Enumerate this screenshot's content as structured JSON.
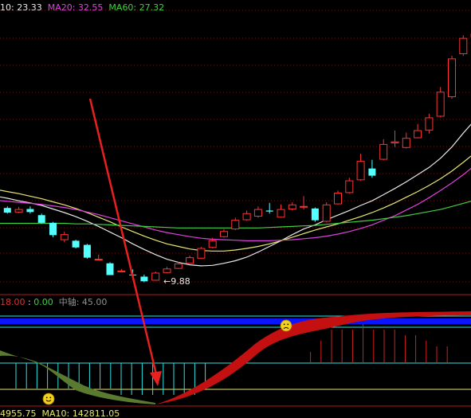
{
  "legend_top": [
    {
      "text": "10: 23.33",
      "color": "#e8e8e8"
    },
    {
      "text": "MA20: 32.55",
      "color": "#e040e0"
    },
    {
      "text": "MA60: 27.32",
      "color": "#40d040"
    }
  ],
  "legend_mid": [
    {
      "text": "18.00",
      "color": "#e03030"
    },
    {
      "text": " : ",
      "color": "#e8e8e8"
    },
    {
      "text": "0.00",
      "color": "#40d040"
    },
    {
      "text": "  中轴: 45.00",
      "color": "#909090"
    }
  ],
  "bottom_left": "4955.75",
  "bottom_ma10": "MA10: 142811.05",
  "low_marker": "9.88",
  "colors": {
    "up": "#ff3232",
    "down": "#54ffff",
    "ma10": "#e8e8e8",
    "ma_mid": "#e8e870",
    "ma20": "#e040e0",
    "ma60": "#40d040",
    "arrow": "#e82020",
    "band_red": "#c41010",
    "band_green": "#5a7a30",
    "blue_band": "#0a14ff"
  },
  "chart_data": [
    {
      "type": "candlestick",
      "series": [
        {
          "name": "candles",
          "ohlc": [
            [
              23.6,
              23.0,
              24.1,
              22.9
            ],
            [
              22.9,
              22.0,
              23.2,
              21.8
            ],
            [
              22.1,
              22.6,
              23.1,
              21.9
            ],
            [
              22.7,
              22.1,
              23.2,
              21.8
            ],
            [
              21.5,
              20.0,
              21.8,
              19.8
            ],
            [
              20.0,
              17.6,
              20.2,
              17.2
            ],
            [
              16.7,
              17.7,
              18.3,
              16.2
            ],
            [
              16.5,
              15.2,
              16.7,
              15.0
            ],
            [
              15.7,
              13.2,
              15.9,
              13.0
            ],
            [
              12.9,
              12.9,
              13.8,
              12.7
            ],
            [
              12.1,
              9.8,
              12.3,
              9.8
            ],
            [
              10.6,
              10.6,
              11.0,
              10.4
            ],
            [
              9.9,
              9.88,
              10.9,
              9.88
            ],
            [
              9.5,
              8.6,
              9.9,
              8.4
            ],
            [
              8.8,
              10.2,
              10.5,
              8.7
            ],
            [
              10.3,
              11.0,
              11.4,
              10.2
            ],
            [
              11.1,
              12.0,
              12.4,
              11.0
            ],
            [
              12.1,
              13.2,
              13.6,
              12.0
            ],
            [
              13.1,
              15.0,
              15.3,
              13.0
            ],
            [
              15.2,
              16.5,
              17.1,
              15.0
            ],
            [
              17.3,
              18.3,
              18.8,
              17.1
            ],
            [
              18.8,
              20.5,
              21.0,
              18.6
            ],
            [
              20.6,
              21.8,
              22.4,
              20.4
            ],
            [
              21.3,
              22.6,
              23.2,
              21.0
            ],
            [
              22.4,
              22.2,
              23.9,
              21.8
            ],
            [
              21.1,
              22.6,
              23.6,
              21.0
            ],
            [
              22.7,
              23.5,
              24.0,
              22.4
            ],
            [
              23.1,
              23.2,
              25.2,
              22.6
            ],
            [
              22.8,
              20.5,
              23.0,
              20.2
            ],
            [
              20.3,
              23.5,
              24.0,
              20.1
            ],
            [
              23.7,
              25.8,
              26.3,
              23.6
            ],
            [
              25.9,
              28.2,
              28.8,
              25.7
            ],
            [
              28.4,
              32.0,
              33.5,
              28.2
            ],
            [
              30.6,
              29.2,
              32.3,
              28.8
            ],
            [
              32.4,
              35.3,
              36.3,
              32.2
            ],
            [
              35.6,
              35.8,
              38.0,
              34.8
            ],
            [
              34.7,
              36.5,
              37.6,
              34.5
            ],
            [
              36.6,
              38.0,
              39.3,
              36.5
            ],
            [
              38.1,
              40.5,
              41.3,
              37.4
            ],
            [
              40.8,
              45.5,
              46.5,
              40.6
            ],
            [
              44.6,
              52.0,
              52.6,
              44.2
            ],
            [
              53.0,
              56.0,
              56.6,
              52.6
            ],
            [
              56.3,
              56.8,
              57.6,
              55.8
            ]
          ]
        },
        {
          "name": "MA10",
          "values": [
            25.2,
            24.8,
            24.3,
            23.9,
            23.4,
            22.7,
            22.0,
            21.2,
            20.3,
            19.3,
            18.2,
            17.1,
            15.9,
            14.8,
            13.8,
            12.9,
            12.3,
            11.8,
            11.6,
            11.7,
            12.1,
            12.6,
            13.3,
            14.3,
            15.4,
            16.5,
            17.7,
            18.8,
            19.6,
            20.6,
            21.5,
            22.4,
            23.4,
            24.3,
            25.5,
            26.7,
            28.0,
            29.4,
            30.8,
            32.6,
            34.8,
            37.5,
            40.0
          ]
        },
        {
          "name": "",
          "values": [
            26.5,
            26.1,
            25.7,
            25.2,
            24.7,
            24.1,
            23.5,
            22.8,
            22.0,
            21.1,
            20.2,
            19.2,
            18.3,
            17.4,
            16.6,
            15.9,
            15.4,
            14.9,
            14.6,
            14.5,
            14.5,
            14.7,
            15.0,
            15.4,
            15.9,
            16.5,
            17.2,
            17.9,
            18.6,
            19.2,
            19.8,
            20.5,
            21.2,
            22.0,
            22.9,
            23.9,
            25.0,
            26.1,
            27.3,
            28.6,
            30.1,
            31.8,
            33.6
          ]
        },
        {
          "name": "MA20",
          "values": [
            24.4,
            24.2,
            24.0,
            23.8,
            23.6,
            23.3,
            23.0,
            22.6,
            22.1,
            21.6,
            21.0,
            20.4,
            19.8,
            19.2,
            18.6,
            18.1,
            17.7,
            17.3,
            17.0,
            16.8,
            16.7,
            16.6,
            16.5,
            16.5,
            16.5,
            16.6,
            16.7,
            16.9,
            17.1,
            17.4,
            17.8,
            18.3,
            18.9,
            19.6,
            20.5,
            21.4,
            22.5,
            23.6,
            24.9,
            26.3,
            27.8,
            29.4,
            31.2
          ]
        },
        {
          "name": "MA60",
          "values": [
            19.9,
            19.9,
            19.9,
            19.9,
            19.9,
            19.9,
            19.9,
            19.8,
            19.8,
            19.7,
            19.6,
            19.5,
            19.4,
            19.3,
            19.2,
            19.1,
            19.0,
            19.0,
            19.0,
            19.0,
            19.0,
            19.0,
            19.0,
            19.0,
            19.1,
            19.2,
            19.3,
            19.4,
            19.5,
            19.7,
            19.9,
            20.1,
            20.3,
            20.5,
            20.8,
            21.1,
            21.4,
            21.8,
            22.2,
            22.6,
            23.2,
            23.8,
            24.4
          ]
        }
      ]
    },
    {
      "type": "histogram",
      "series": [
        {
          "name": "red_bars",
          "values": [
            0,
            0,
            0,
            0,
            0,
            0,
            0,
            0,
            0,
            0,
            0,
            0,
            0,
            0,
            0,
            0,
            0,
            0,
            0,
            0,
            0,
            0,
            0,
            0,
            0,
            0,
            0,
            0,
            2,
            4,
            6,
            6,
            6,
            7,
            6,
            6,
            6,
            5,
            5,
            4,
            3,
            3
          ]
        },
        {
          "name": "cyan_bars",
          "values": [
            4,
            4,
            4,
            4,
            4,
            4,
            4,
            4,
            4,
            4,
            5,
            5,
            5,
            5,
            5,
            5,
            5,
            5,
            4,
            0,
            0,
            0,
            0,
            0,
            0,
            0,
            0,
            0,
            0,
            0,
            0,
            0,
            0,
            0,
            0,
            0,
            0,
            0,
            0,
            0,
            0,
            0
          ]
        }
      ]
    }
  ]
}
